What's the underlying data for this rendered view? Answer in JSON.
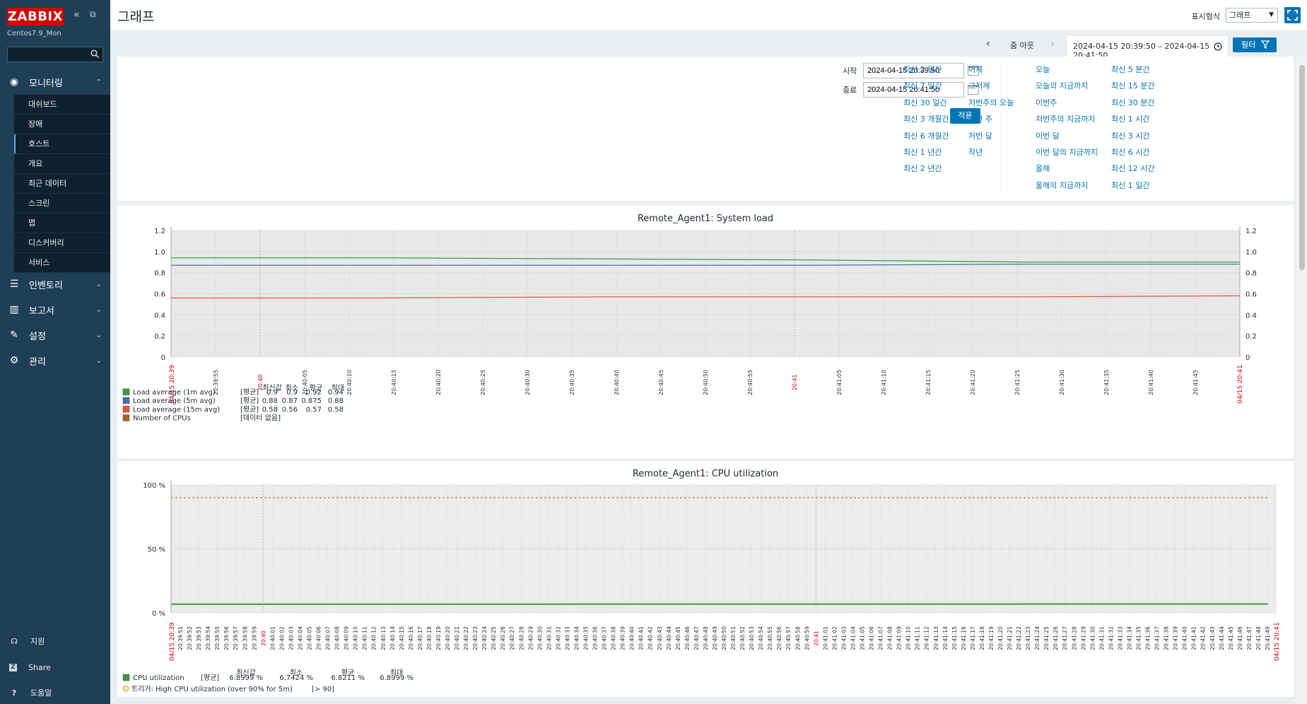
{
  "sidebar": {
    "logo": "ZABBIX",
    "server_name": "Centos7.9_Mon",
    "search_placeholder": "",
    "sections": [
      {
        "label": "모니터링",
        "icon": "eye-icon"
      },
      {
        "label": "인벤토리",
        "icon": "list-icon"
      },
      {
        "label": "보고서",
        "icon": "bar-chart-icon"
      },
      {
        "label": "설정",
        "icon": "wrench-icon"
      },
      {
        "label": "관리",
        "icon": "gear-icon"
      }
    ],
    "monitoring_items": [
      "대쉬보드",
      "장애",
      "호스트",
      "개요",
      "최근 데이터",
      "스크린",
      "맵",
      "디스커버리",
      "서비스"
    ],
    "footer": [
      {
        "label": "지원",
        "icon": "headset-icon"
      },
      {
        "label": "Share",
        "icon": "share-icon"
      },
      {
        "label": "도움말",
        "icon": "help-icon"
      }
    ]
  },
  "header": {
    "title": "그래프",
    "view_label": "표시형식",
    "view_value": "그래프"
  },
  "timebar": {
    "zoom_out": "줌 아웃",
    "range": "2024-04-15 20:39:50 – 2024-04-15 20:41:50",
    "filter_label": "필터"
  },
  "filter": {
    "from_label": "시작",
    "from_value": "2024-04-15 20:39:50",
    "to_label": "종료",
    "to_value": "2024-04-15 20:41:50",
    "apply_label": "적용",
    "quick": [
      [
        "최신 2 일간",
        "최신 7 일간",
        "최신 30 일간",
        "최신 3 개월간",
        "최신 6 개월간",
        "최신 1 년간",
        "최신 2 년간"
      ],
      [
        "어제",
        "그저께",
        "저번주의 오늘",
        "저번 주",
        "저번 달",
        "작년"
      ],
      [
        "오늘",
        "오늘의 지금까지",
        "이번주",
        "저번주의 지금까지",
        "이번 달",
        "이번 달의 지금까지",
        "올해",
        "올해의 지금까지"
      ],
      [
        "최신 5 분간",
        "최신 15 분간",
        "최신 30 분간",
        "최신 1 시간",
        "최신 3 시간",
        "최신 6 시간",
        "최신 12 시간",
        "최신 1 일간"
      ]
    ]
  },
  "graphs": [
    {
      "title": "Remote_Agent1: System load",
      "legend_header": [
        "최신값",
        "최소",
        "평균",
        "최대"
      ],
      "legend": [
        {
          "name": "Load average (1m avg)",
          "func": "[평균]",
          "color": "#3a9a3a",
          "last": "0.9",
          "min": "0.9",
          "avg": "0.92",
          "max": "0.94"
        },
        {
          "name": "Load average (5m avg)",
          "func": "[평균]",
          "color": "#4a6fa8",
          "last": "0.88",
          "min": "0.87",
          "avg": "0.875",
          "max": "0.88"
        },
        {
          "name": "Load average (15m avg)",
          "func": "[평균]",
          "color": "#e8553a",
          "last": "0.58",
          "min": "0.56",
          "avg": "0.57",
          "max": "0.58"
        },
        {
          "name": "Number of CPUs",
          "func": "[데이터 없음]",
          "color": "#b0602a",
          "last": "",
          "min": "",
          "avg": "",
          "max": ""
        }
      ]
    },
    {
      "title": "Remote_Agent1: CPU utilization",
      "legend_header": [
        "최신값",
        "최소",
        "평균",
        "최대"
      ],
      "legend": [
        {
          "name": "CPU utilization",
          "func": "[평균]",
          "color": "#3a9a3a",
          "last": "6.8999 %",
          "min": "6.7424 %",
          "avg": "6.8211 %",
          "max": "6.8999 %"
        }
      ],
      "trigger": {
        "text": "트리거: High CPU utilization (over 90% for 5m)",
        "threshold": "[> 90]",
        "color": "#e0a040"
      }
    }
  ],
  "chart_data": [
    {
      "type": "line",
      "title": "Remote_Agent1: System load",
      "x_start": "04/15 20:39",
      "x_end": "04/15 20:41",
      "x_ticks": [
        "20:39:55",
        "20:40",
        "20:40:05",
        "20:40:10",
        "20:40:15",
        "20:40:20",
        "20:40:25",
        "20:40:30",
        "20:40:35",
        "20:40:40",
        "20:40:45",
        "20:40:50",
        "20:40:55",
        "20:41",
        "20:41:05",
        "20:41:10",
        "20:41:15",
        "20:41:20",
        "20:41:25",
        "20:41:30",
        "20:41:35",
        "20:41:40",
        "20:41:45"
      ],
      "y_ticks": [
        "0",
        "0.2",
        "0.4",
        "0.6",
        "0.8",
        "1.0",
        "1.2"
      ],
      "ylim": [
        0,
        1.2
      ],
      "series": [
        {
          "name": "Load average (1m avg)",
          "color": "#3a9a3a",
          "values": [
            0.94,
            0.94,
            0.93,
            0.92,
            0.9,
            0.9
          ]
        },
        {
          "name": "Load average (5m avg)",
          "color": "#4a6fa8",
          "values": [
            0.87,
            0.87,
            0.87,
            0.87,
            0.88,
            0.88
          ]
        },
        {
          "name": "Load average (15m avg)",
          "color": "#e8553a",
          "values": [
            0.56,
            0.56,
            0.57,
            0.57,
            0.57,
            0.58
          ]
        }
      ]
    },
    {
      "type": "line",
      "title": "Remote_Agent1: CPU utilization",
      "x_start": "04/15 20:39",
      "x_end": "04/15 20:41",
      "y_ticks": [
        "0 %",
        "50 %",
        "100 %"
      ],
      "ylim": [
        0,
        100
      ],
      "x_tick_labels": [
        "20:39:51",
        "20:39:52",
        "20:39:53",
        "20:39:54",
        "20:39:55",
        "20:39:56",
        "20:39:57",
        "20:39:58",
        "20:39:59",
        "20:40",
        "20:40:01",
        "20:40:02",
        "20:40:03",
        "20:40:04",
        "20:40:05",
        "20:40:06",
        "20:40:07",
        "20:40:08",
        "20:40:09",
        "20:40:10",
        "20:40:11",
        "20:40:12",
        "20:40:13",
        "20:40:14",
        "20:40:15",
        "20:40:16",
        "20:40:17",
        "20:40:18",
        "20:40:19",
        "20:40:20",
        "20:40:21",
        "20:40:22",
        "20:40:23",
        "20:40:24",
        "20:40:25",
        "20:40:26",
        "20:40:27",
        "20:40:28",
        "20:40:29",
        "20:40:30",
        "20:40:31",
        "20:40:32",
        "20:40:33",
        "20:40:34",
        "20:40:35",
        "20:40:36",
        "20:40:37",
        "20:40:38",
        "20:40:39",
        "20:40:40",
        "20:40:41",
        "20:40:42",
        "20:40:43",
        "20:40:44",
        "20:40:45",
        "20:40:46",
        "20:40:47",
        "20:40:48",
        "20:40:49",
        "20:40:50",
        "20:40:51",
        "20:40:52",
        "20:40:53",
        "20:40:54",
        "20:40:55",
        "20:40:56",
        "20:40:57",
        "20:40:58",
        "20:40:59",
        "20:41",
        "20:41:01",
        "20:41:02",
        "20:41:03",
        "20:41:04",
        "20:41:05",
        "20:41:06",
        "20:41:07",
        "20:41:08",
        "20:41:09",
        "20:41:10",
        "20:41:11",
        "20:41:12",
        "20:41:13",
        "20:41:14",
        "20:41:15",
        "20:41:16",
        "20:41:17",
        "20:41:18",
        "20:41:19",
        "20:41:20",
        "20:41:21",
        "20:41:22",
        "20:41:23",
        "20:41:24",
        "20:41:25",
        "20:41:26",
        "20:41:27",
        "20:41:28",
        "20:41:29",
        "20:41:30",
        "20:41:31",
        "20:41:32",
        "20:41:33",
        "20:41:34",
        "20:41:35",
        "20:41:36",
        "20:41:37",
        "20:41:38",
        "20:41:39",
        "20:41:40",
        "20:41:41",
        "20:41:42",
        "20:41:43",
        "20:41:44",
        "20:41:45",
        "20:41:46",
        "20:41:47",
        "20:41:48",
        "20:41:49"
      ],
      "series": [
        {
          "name": "CPU utilization",
          "color": "#3a9a3a",
          "values": [
            6.74,
            6.8,
            6.85,
            6.9
          ]
        }
      ],
      "threshold": 90
    }
  ]
}
